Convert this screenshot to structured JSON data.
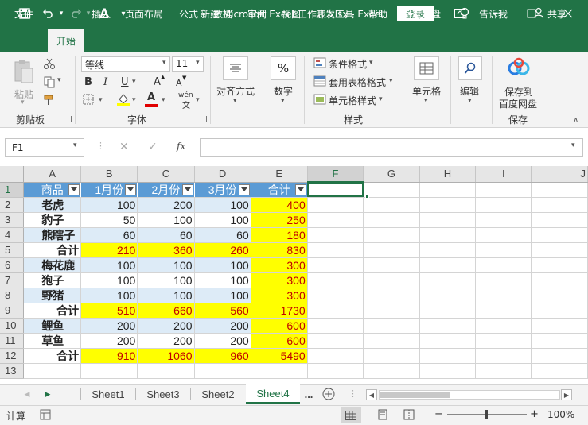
{
  "window": {
    "title": "新建 Microsoft Excel 工作表.xlsx  -  Excel",
    "login": "登录",
    "accent": "#217346"
  },
  "ribbon_tabs": [
    "文件",
    "开始",
    "插入",
    "页面布局",
    "公式",
    "数据",
    "审阅",
    "视图",
    "开发工具",
    "帮助",
    "百度网盘"
  ],
  "active_tab": "开始",
  "tellme": "告诉我",
  "share": "共享",
  "clipboard": {
    "paste": "粘贴",
    "label": "剪贴板"
  },
  "font": {
    "name": "等线",
    "size": "11",
    "label": "字体",
    "bold": "B",
    "italic": "I",
    "underline": "U",
    "grow": "A",
    "shrink": "A",
    "color_a": "A",
    "phonetic": "wén"
  },
  "alignment": {
    "label": "对齐方式"
  },
  "number": {
    "label": "数字",
    "symbol": "%"
  },
  "styles": {
    "conditional": "条件格式",
    "table": "套用表格格式",
    "cell": "单元格样式",
    "label": "样式"
  },
  "cells": {
    "label": "单元格"
  },
  "editing": {
    "label": "编辑"
  },
  "baidu": {
    "label": "保存到\n百度网盘",
    "line1": "保存到",
    "line2": "百度网盘",
    "group": "保存"
  },
  "formula_bar": {
    "namebox": "F1",
    "fx": "fx",
    "value": ""
  },
  "grid": {
    "columns": [
      "A",
      "B",
      "C",
      "D",
      "E",
      "F",
      "G",
      "H",
      "I",
      "J"
    ],
    "header": [
      "商品",
      "1月份",
      "2月份",
      "3月份",
      "合计"
    ],
    "rows": [
      {
        "n": "2",
        "a": "老虎",
        "b": "100",
        "c": "200",
        "d": "100",
        "e": "400"
      },
      {
        "n": "3",
        "a": "豹子",
        "b": "50",
        "c": "100",
        "d": "100",
        "e": "250"
      },
      {
        "n": "4",
        "a": "熊瞎子",
        "b": "60",
        "c": "60",
        "d": "60",
        "e": "180"
      },
      {
        "n": "5",
        "a": "合计",
        "b": "210",
        "c": "360",
        "d": "260",
        "e": "830"
      },
      {
        "n": "6",
        "a": "梅花鹿",
        "b": "100",
        "c": "100",
        "d": "100",
        "e": "300"
      },
      {
        "n": "7",
        "a": "狍子",
        "b": "100",
        "c": "100",
        "d": "100",
        "e": "300"
      },
      {
        "n": "8",
        "a": "野猪",
        "b": "100",
        "c": "100",
        "d": "100",
        "e": "300"
      },
      {
        "n": "9",
        "a": "合计",
        "b": "510",
        "c": "660",
        "d": "560",
        "e": "1730"
      },
      {
        "n": "10",
        "a": "鲤鱼",
        "b": "200",
        "c": "200",
        "d": "200",
        "e": "600"
      },
      {
        "n": "11",
        "a": "草鱼",
        "b": "200",
        "c": "200",
        "d": "200",
        "e": "600"
      },
      {
        "n": "12",
        "a": "合计",
        "b": "910",
        "c": "1060",
        "d": "960",
        "e": "5490"
      },
      {
        "n": "13",
        "a": "",
        "b": "",
        "c": "",
        "d": "",
        "e": ""
      }
    ]
  },
  "sheets": [
    "Sheet1",
    "Sheet3",
    "Sheet2",
    "Sheet4"
  ],
  "active_sheet": "Sheet4",
  "more_sheets": "...",
  "status": {
    "mode": "计算",
    "zoom": "100%",
    "zoom_minus": "−",
    "zoom_plus": "+"
  }
}
